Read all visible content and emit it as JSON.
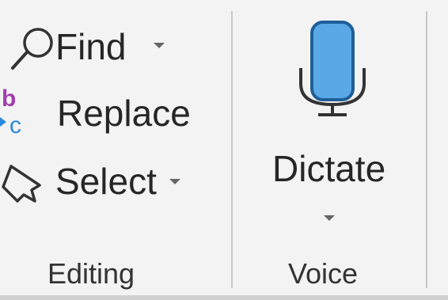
{
  "editing": {
    "find": {
      "label": "Find",
      "icon": "search-icon"
    },
    "replace": {
      "label": "Replace",
      "icon": "replace-icon",
      "icon_letters": [
        "b",
        "c"
      ],
      "letter_colors": [
        "#a13fae",
        "#2b8ad9"
      ]
    },
    "select": {
      "label": "Select",
      "icon": "cursor-select-icon"
    },
    "group_label": "Editing"
  },
  "voice": {
    "dictate": {
      "label": "Dictate",
      "icon": "microphone-icon",
      "mic_fill": "#5aa9e6",
      "mic_stroke": "#1f5f99"
    },
    "group_label": "Voice"
  }
}
